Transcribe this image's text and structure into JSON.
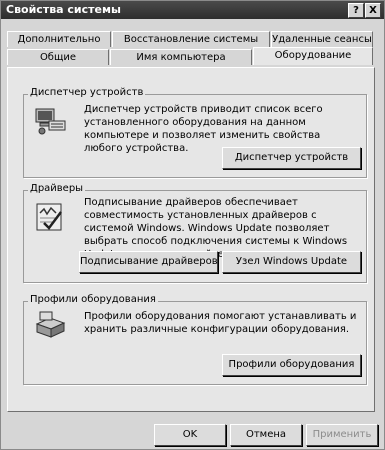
{
  "window": {
    "title": "Свойства системы",
    "help_button": "?",
    "close_button": "X"
  },
  "tabs_row1": [
    "Дополнительно",
    "Восстановление системы",
    "Удаленные сеансы"
  ],
  "tabs_row2": [
    "Общие",
    "Имя компьютера",
    "Оборудование"
  ],
  "active_tab": "Оборудование",
  "device_manager": {
    "title": "Диспетчер устройств",
    "description": "Диспетчер устройств приводит список всего установленного оборудования на данном компьютере и позволяет изменить свойства любого устройства.",
    "button": "Диспетчер устройств",
    "icon": "device-manager-icon"
  },
  "drivers": {
    "title": "Драйверы",
    "description": "Подписывание драйверов обеспечивает совместимость установленных драйверов с системой Windows.  Windows Update позволяет выбрать способ подключения системы к Windows Update для поиска драйверов.",
    "signing_button": "Подписывание драйверов",
    "update_button": "Узел Windows Update",
    "icon": "driver-signing-icon"
  },
  "hardware_profiles": {
    "title": "Профили оборудования",
    "description": "Профили оборудования помогают устанавливать и хранить различные конфигурации оборудования.",
    "button": "Профили оборудования",
    "icon": "hardware-profiles-icon"
  },
  "footer": {
    "ok": "OK",
    "cancel": "Отмена",
    "apply": "Применить"
  }
}
